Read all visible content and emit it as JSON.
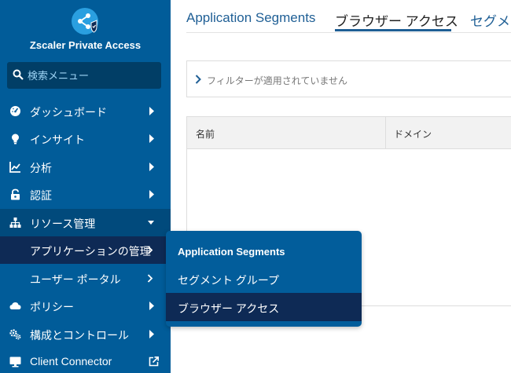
{
  "app": {
    "name": "Zscaler Private Access"
  },
  "search": {
    "placeholder": "検索メニュー"
  },
  "sidebar": {
    "items": [
      {
        "label": "ダッシュボード",
        "icon": "dashboard-icon"
      },
      {
        "label": "インサイト",
        "icon": "lightbulb-icon"
      },
      {
        "label": "分析",
        "icon": "analytics-icon"
      },
      {
        "label": "認証",
        "icon": "lock-icon"
      },
      {
        "label": "リソース管理",
        "icon": "sitemap-icon"
      },
      {
        "label": "ポリシー",
        "icon": "cloud-icon"
      },
      {
        "label": "構成とコントロール",
        "icon": "cogs-icon"
      },
      {
        "label": "Client Connector",
        "icon": "external-link-icon"
      }
    ],
    "sub_items": [
      {
        "label": "アプリケーションの管理"
      },
      {
        "label": "ユーザー ポータル"
      }
    ]
  },
  "tabs": [
    {
      "label": "Application Segments"
    },
    {
      "label": "ブラウザー アクセス"
    },
    {
      "label": "セグメ"
    }
  ],
  "filter": {
    "text": "フィルターが適用されていません"
  },
  "table": {
    "columns": [
      "名前",
      "ドメイン"
    ]
  },
  "flyout": {
    "items": [
      {
        "label": "Application Segments"
      },
      {
        "label": "セグメント グループ"
      },
      {
        "label": "ブラウザー アクセス"
      }
    ]
  },
  "colors": {
    "sidebar": "#015c99",
    "search_bg": "#013e66",
    "selected": "#0e2a55",
    "accent_text": "#1f5f95"
  }
}
